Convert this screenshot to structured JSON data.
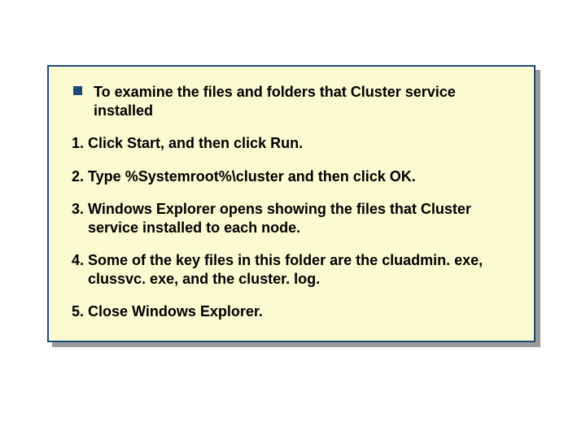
{
  "lead": "To examine the files and folders that Cluster service installed",
  "steps": [
    "1. Click Start, and then click Run.",
    "2. Type %Systemroot%\\cluster and then click OK.",
    "3. Windows Explorer opens showing the files that Cluster service installed to each node.",
    "4. Some of the key files in this folder are the cluadmin. exe, clussvc. exe, and the cluster. log.",
    "5. Close Windows Explorer."
  ]
}
